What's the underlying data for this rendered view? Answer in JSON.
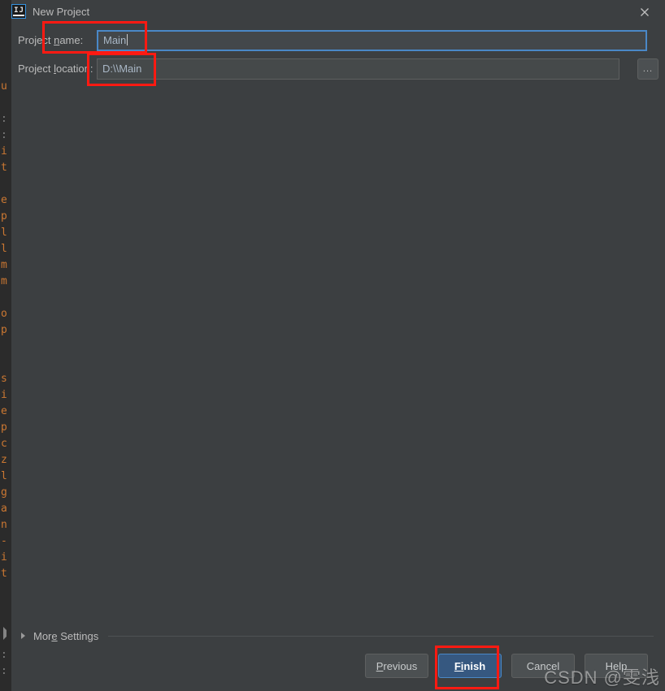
{
  "window": {
    "title": "New Project",
    "logo_label": "IJ",
    "close_icon": "close-icon"
  },
  "form": {
    "rows": [
      {
        "label_prefix": "Project ",
        "label_mnemonic": "n",
        "label_suffix": "ame:",
        "value": "Main",
        "placeholder": "",
        "focused": true
      },
      {
        "label_prefix": "Project ",
        "label_mnemonic": "l",
        "label_suffix": "ocation:",
        "value": "D:\\\\Main",
        "placeholder": "",
        "focused": false
      }
    ],
    "browse_button_label": "...",
    "browse_icon": "ellipsis-icon"
  },
  "more_settings": {
    "label_prefix": "Mor",
    "label_mnemonic": "e",
    "label_suffix": " Settings",
    "arrow_icon": "chevron-right-icon",
    "expanded": false
  },
  "buttons": [
    {
      "prefix": "",
      "mnemonic": "P",
      "suffix": "revious",
      "default": false,
      "name": "previous-button"
    },
    {
      "prefix": "",
      "mnemonic": "Fi",
      "suffix": "nish",
      "default": true,
      "name": "finish-button"
    },
    {
      "prefix": "Cancel",
      "mnemonic": "",
      "suffix": "",
      "default": false,
      "name": "cancel-button"
    },
    {
      "prefix": "Help",
      "mnemonic": "",
      "suffix": "",
      "default": false,
      "name": "help-button"
    }
  ],
  "watermark": "CSDN @雯浅",
  "ide_background": {
    "fragments": [
      "u",
      "",
      ":",
      ":",
      "i",
      "t",
      "",
      "e",
      "p",
      "l",
      "l",
      "m",
      "m",
      "",
      "o",
      "p",
      "",
      "",
      "s",
      "i",
      "e",
      "p",
      "c",
      "z",
      "l",
      "g",
      "a",
      "n",
      "-",
      "i",
      "t",
      "",
      "",
      "",
      "",
      ":",
      ":"
    ]
  },
  "colors": {
    "dialog_background": "#3c3f41",
    "ide_background": "#2b2b2b",
    "accent_focus": "#4a88c7",
    "default_button": "#365880",
    "annotation_red": "#ff1a12",
    "label_text": "#bbbbbb",
    "field_text": "#a9b7c6",
    "code_orange": "#cc7832"
  }
}
